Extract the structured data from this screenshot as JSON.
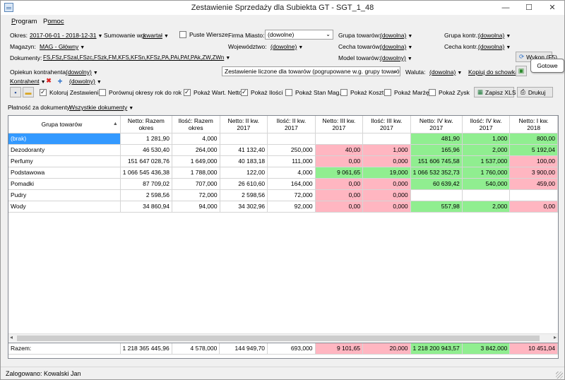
{
  "window": {
    "title": "Zestawienie Sprzedaży dla Subiekta GT - SGT_1_48",
    "minimize": "—",
    "maximize": "☐",
    "close": "✕"
  },
  "menu": [
    {
      "hot": "P",
      "rest": "rogram"
    },
    {
      "hot": "P",
      "rest": "omoc"
    }
  ],
  "filters": {
    "okres_label": "Okres:",
    "okres_value": "2017-06-01 - 2018-12-31",
    "sumowanie_label": "Sumowanie wg:",
    "sumowanie_value": "kwartał",
    "puste_wiersze": "Puste Wiersze",
    "firma_miasto_label": "Firma Miasto:",
    "firma_miasto_value": "(dowolne)",
    "grupa_towarow_label": "Grupa towarów:",
    "grupa_towarow_value": "(dowolna)",
    "grupa_kontr_label": "Grupa kontr.:",
    "grupa_kontr_value": "(dowolna)",
    "magazyn_label": "Magazyn:",
    "magazyn_value": "MAG - Główny",
    "wojewodztwo_label": "Województwo:",
    "wojewodztwo_value": "(dowolne)",
    "cecha_towarow_label": "Cecha towarów:",
    "cecha_towarow_value": "(dowolna)",
    "cecha_kontr_label": "Cecha kontr.:",
    "cecha_kontr_value": "(dowolna)",
    "dokumenty_label": "Dokumenty:",
    "dokumenty_value": "FS,FSz,FSzal,FSzc,FSzk,FM,KFS,KFSn,KFSz,PA,PAi,PAf,PAk,ZW,ZWn",
    "model_towarow_label": "Model towarów:",
    "model_towarow_value": "(dowolny)",
    "wykonaj_label": "Wykon (F5)",
    "opiekun_label": "Opiekun kontrahenta:",
    "opiekun_value": "(dowolny)",
    "zestawienie_value": "Zestawienie liczone dla towarów (pogrupowane w.g. grupy towarów)",
    "waluta_label": "Waluta:",
    "waluta_value": "(dowolna)",
    "kopiuj_label": "Kopiuj do schowka",
    "kontrahent_label": "Kontrahent",
    "kontrahent_value": "(dowolny)",
    "platnosc_label": "Płatność za dokumenty:",
    "platnosc_value": "Wszystkie dokumenty"
  },
  "options": {
    "koloruj": "Koloruj Zestawienia",
    "porownuj": "Porównuj okresy rok do rok",
    "pokaz_wart_netto": "Pokaż Wart. Netto",
    "pokaz_ilosci": "Pokaż Ilości",
    "pokaz_stan_mag": "Pokaż Stan Mag.",
    "pokaz_koszt": "Pokaż Koszt",
    "pokaz_marze": "Pokaż Marżę",
    "pokaz_zysk": "Pokaż Zysk",
    "zapisz_xls": "Zapisz XLS",
    "drukuj": "Drukuj"
  },
  "tooltip": "Gotowe",
  "table": {
    "headers": [
      "Grupa towarów",
      "Netto: Razem okres",
      "Ilość: Razem okres",
      "Netto: II kw. 2017",
      "Ilość: II kw. 2017",
      "Netto: III kw. 2017",
      "Ilość: III kw. 2017",
      "Netto: IV kw. 2017",
      "Ilość: IV kw. 2017",
      "Netto: I kw. 2018"
    ],
    "rows": [
      {
        "cells": [
          "(brak)",
          "1 281,90",
          "4,000",
          "",
          "",
          "",
          "",
          "481,90",
          "1,000",
          "800,00"
        ],
        "colors": [
          "sel",
          "",
          "",
          "",
          "",
          "",
          "",
          "g",
          "g",
          "g"
        ]
      },
      {
        "cells": [
          "Dezodoranty",
          "46 530,40",
          "264,000",
          "41 132,40",
          "250,000",
          "40,00",
          "1,000",
          "165,96",
          "2,000",
          "5 192,04"
        ],
        "colors": [
          "",
          "",
          "",
          "",
          "",
          "r",
          "r",
          "g",
          "g",
          "g"
        ]
      },
      {
        "cells": [
          "Perfumy",
          "151 647 028,76",
          "1 649,000",
          "40 183,18",
          "111,000",
          "0,00",
          "0,000",
          "151 606 745,58",
          "1 537,000",
          "100,00"
        ],
        "colors": [
          "",
          "",
          "",
          "",
          "",
          "r",
          "r",
          "g",
          "g",
          "r"
        ]
      },
      {
        "cells": [
          "Podstawowa",
          "1 066 545 436,38",
          "1 788,000",
          "122,00",
          "4,000",
          "9 061,65",
          "19,000",
          "1 066 532 352,73",
          "1 760,000",
          "3 900,00"
        ],
        "colors": [
          "",
          "",
          "",
          "",
          "",
          "g",
          "g",
          "g",
          "g",
          "r"
        ]
      },
      {
        "cells": [
          "Pomadki",
          "87 709,02",
          "707,000",
          "26 610,60",
          "164,000",
          "0,00",
          "0,000",
          "60 639,42",
          "540,000",
          "459,00"
        ],
        "colors": [
          "",
          "",
          "",
          "",
          "",
          "r",
          "r",
          "g",
          "g",
          "r"
        ]
      },
      {
        "cells": [
          "Pudry",
          "2 598,56",
          "72,000",
          "2 598,56",
          "72,000",
          "0,00",
          "0,000",
          "",
          "",
          ""
        ],
        "colors": [
          "",
          "",
          "",
          "",
          "",
          "r",
          "r",
          "",
          "",
          ""
        ]
      },
      {
        "cells": [
          "Wody",
          "34 860,94",
          "94,000",
          "34 302,96",
          "92,000",
          "0,00",
          "0,000",
          "557,98",
          "2,000",
          "0,00"
        ],
        "colors": [
          "",
          "",
          "",
          "",
          "",
          "r",
          "r",
          "g",
          "g",
          "r"
        ]
      }
    ],
    "totals": {
      "cells": [
        "Razem:",
        "1 218 365 445,96",
        "4 578,000",
        "144 949,70",
        "693,000",
        "9 101,65",
        "20,000",
        "1 218 200 943,57",
        "3 842,000",
        "10 451,04"
      ],
      "colors": [
        "",
        "",
        "",
        "",
        "",
        "r",
        "r",
        "g",
        "g",
        "r"
      ]
    }
  },
  "status": "Zalogowano: Kowalski Jan"
}
